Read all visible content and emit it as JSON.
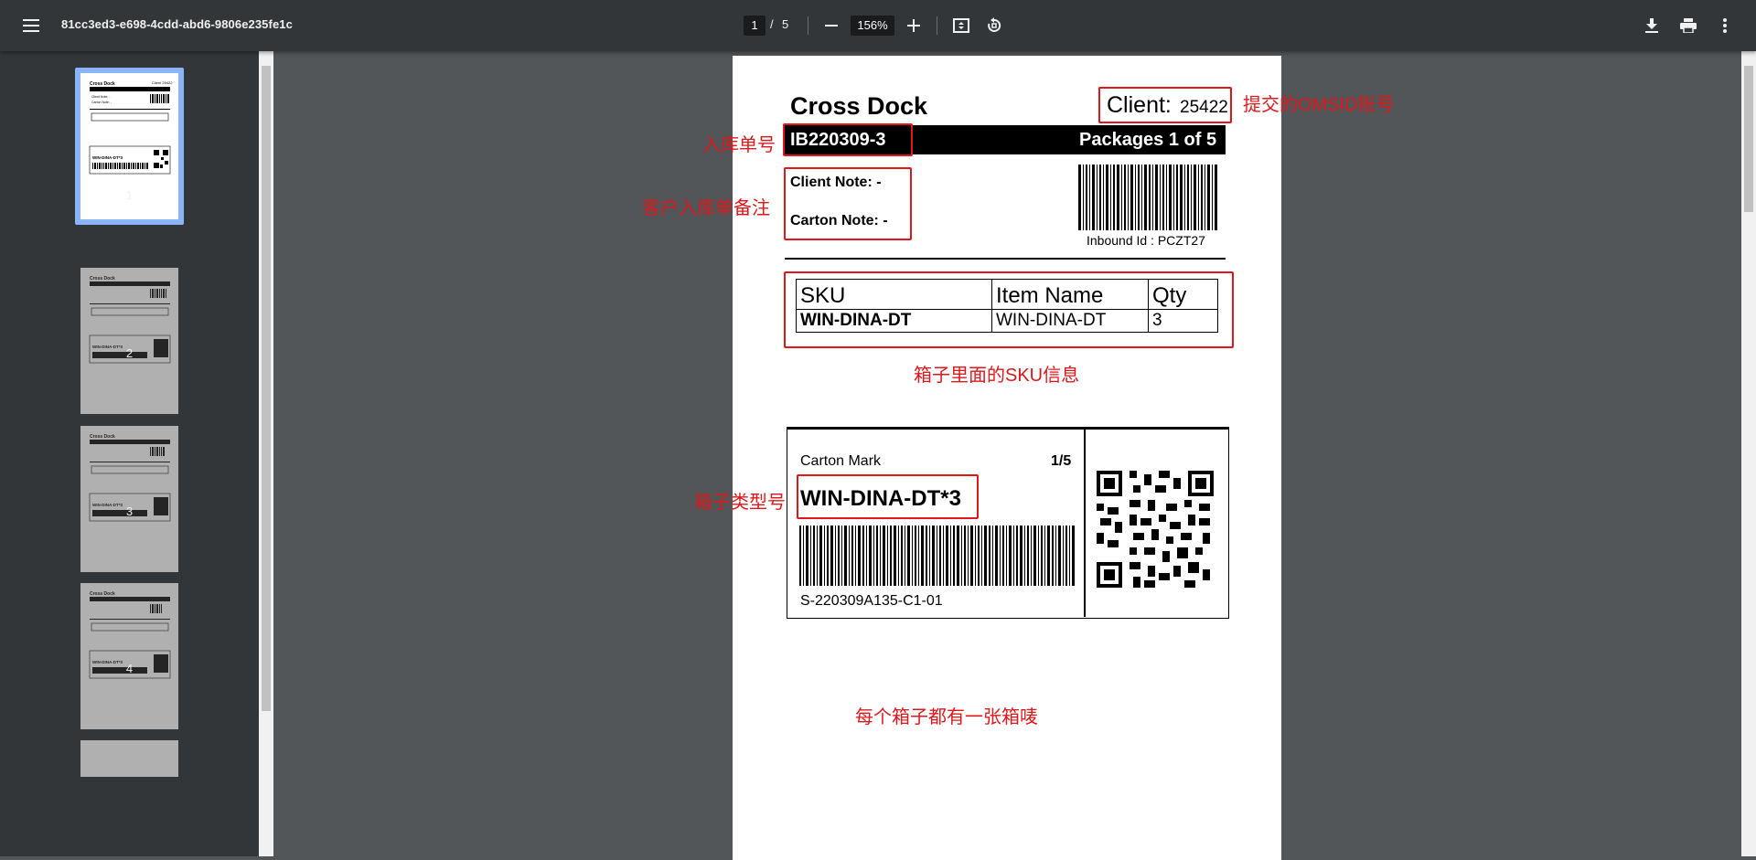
{
  "toolbar": {
    "title": "81cc3ed3-e698-4cdd-abd6-9806e235fe1c",
    "current_page": "1",
    "page_sep": "/",
    "total_pages": "5",
    "zoom": "156%",
    "icons": [
      "menu-icon",
      "zoom-out-icon",
      "zoom-in-icon",
      "fit-page-icon",
      "rotate-icon",
      "download-icon",
      "print-icon",
      "more-vert-icon"
    ]
  },
  "thumbnails": [
    {
      "num": "1",
      "selected": true
    },
    {
      "num": "2",
      "selected": false
    },
    {
      "num": "3",
      "selected": false
    },
    {
      "num": "4",
      "selected": false
    }
  ],
  "label": {
    "title": "Cross Dock",
    "client_label": "Client:",
    "client_value": "25422",
    "inbound_no": "IB220309-3",
    "packages": "Packages 1 of 5",
    "client_note": "Client Note: -",
    "carton_note": "Carton Note: -",
    "inbound_id": "Inbound Id : PCZT27",
    "table": {
      "headers": [
        "SKU",
        "Item Name",
        "Qty"
      ],
      "rows": [
        [
          "WIN-DINA-DT",
          "WIN-DINA-DT",
          "3"
        ]
      ]
    },
    "carton_mark": "Carton Mark",
    "carton_count": "1/5",
    "carton_type": "WIN-DINA-DT*3",
    "carton_code": "S-220309A135-C1-01"
  },
  "annotations": {
    "client": "提交的OMSID账号",
    "inbound_no": "入库单号",
    "notes": "客户入库单备注",
    "sku_info": "箱子里面的SKU信息",
    "carton_type": "箱子类型号",
    "per_carton": "每个箱子都有一张箱唛"
  },
  "colors": {
    "toolbar": "#323639",
    "viewer": "#525659",
    "annotation": "#e0171a",
    "selection": "#8ab4f8"
  }
}
